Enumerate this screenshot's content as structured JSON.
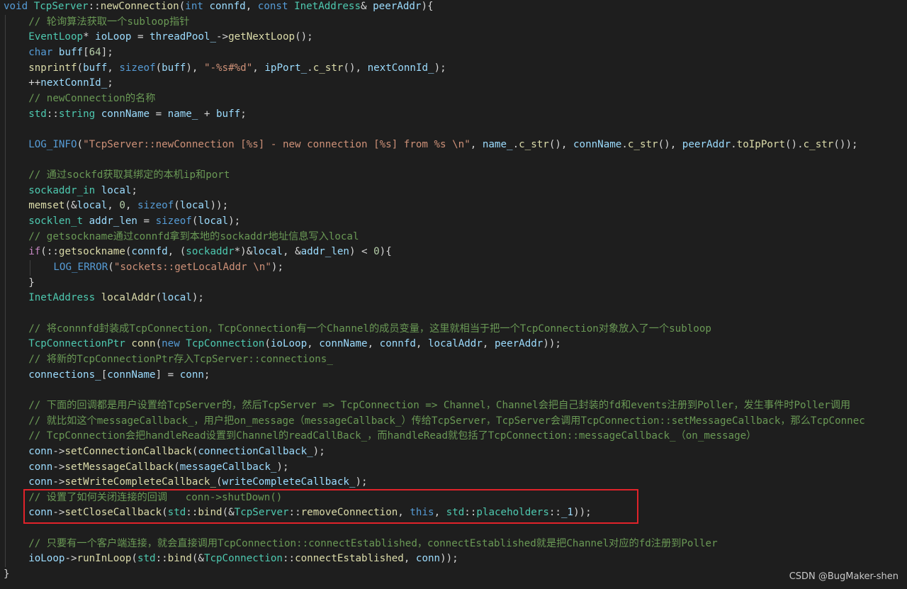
{
  "lines": [
    {
      "indent": 0,
      "tokens": [
        [
          "kw",
          "void"
        ],
        [
          "op",
          " "
        ],
        [
          "type",
          "TcpServer"
        ],
        [
          "op",
          "::"
        ],
        [
          "fn",
          "newConnection"
        ],
        [
          "op",
          "("
        ],
        [
          "kw",
          "int"
        ],
        [
          "op",
          " "
        ],
        [
          "var",
          "connfd"
        ],
        [
          "op",
          ", "
        ],
        [
          "kw",
          "const"
        ],
        [
          "op",
          " "
        ],
        [
          "type",
          "InetAddress"
        ],
        [
          "op",
          "& "
        ],
        [
          "var",
          "peerAddr"
        ],
        [
          "op",
          "){"
        ]
      ]
    },
    {
      "indent": 1,
      "tokens": [
        [
          "cmt",
          "// 轮询算法获取一个subloop指针"
        ]
      ]
    },
    {
      "indent": 1,
      "tokens": [
        [
          "type",
          "EventLoop"
        ],
        [
          "op",
          "* "
        ],
        [
          "var",
          "ioLoop"
        ],
        [
          "op",
          " = "
        ],
        [
          "var",
          "threadPool_"
        ],
        [
          "op",
          "->"
        ],
        [
          "fn",
          "getNextLoop"
        ],
        [
          "op",
          "();"
        ]
      ]
    },
    {
      "indent": 1,
      "tokens": [
        [
          "kw",
          "char"
        ],
        [
          "op",
          " "
        ],
        [
          "var",
          "buff"
        ],
        [
          "op",
          "["
        ],
        [
          "num",
          "64"
        ],
        [
          "op",
          "];"
        ]
      ]
    },
    {
      "indent": 1,
      "tokens": [
        [
          "fn",
          "snprintf"
        ],
        [
          "op",
          "("
        ],
        [
          "var",
          "buff"
        ],
        [
          "op",
          ", "
        ],
        [
          "kw",
          "sizeof"
        ],
        [
          "op",
          "("
        ],
        [
          "var",
          "buff"
        ],
        [
          "op",
          "), "
        ],
        [
          "str",
          "\"-%s#%d\""
        ],
        [
          "op",
          ", "
        ],
        [
          "var",
          "ipPort_"
        ],
        [
          "op",
          "."
        ],
        [
          "fn",
          "c_str"
        ],
        [
          "op",
          "(), "
        ],
        [
          "var",
          "nextConnId_"
        ],
        [
          "op",
          ");"
        ]
      ]
    },
    {
      "indent": 1,
      "tokens": [
        [
          "op",
          "++"
        ],
        [
          "var",
          "nextConnId_"
        ],
        [
          "op",
          ";"
        ]
      ]
    },
    {
      "indent": 1,
      "tokens": [
        [
          "cmt",
          "// newConnection的名称"
        ]
      ]
    },
    {
      "indent": 1,
      "tokens": [
        [
          "ns",
          "std"
        ],
        [
          "op",
          "::"
        ],
        [
          "type",
          "string"
        ],
        [
          "op",
          " "
        ],
        [
          "var",
          "connName"
        ],
        [
          "op",
          " = "
        ],
        [
          "var",
          "name_"
        ],
        [
          "op",
          " + "
        ],
        [
          "var",
          "buff"
        ],
        [
          "op",
          ";"
        ]
      ]
    },
    {
      "indent": 0,
      "tokens": []
    },
    {
      "indent": 1,
      "tokens": [
        [
          "mac",
          "LOG_INFO"
        ],
        [
          "op",
          "("
        ],
        [
          "str",
          "\"TcpServer::newConnection [%s] - new connection [%s] from %s \\n\""
        ],
        [
          "op",
          ", "
        ],
        [
          "var",
          "name_"
        ],
        [
          "op",
          "."
        ],
        [
          "fn",
          "c_str"
        ],
        [
          "op",
          "(), "
        ],
        [
          "var",
          "connName"
        ],
        [
          "op",
          "."
        ],
        [
          "fn",
          "c_str"
        ],
        [
          "op",
          "(), "
        ],
        [
          "var",
          "peerAddr"
        ],
        [
          "op",
          "."
        ],
        [
          "fn",
          "toIpPort"
        ],
        [
          "op",
          "()."
        ],
        [
          "fn",
          "c_str"
        ],
        [
          "op",
          "());"
        ]
      ]
    },
    {
      "indent": 0,
      "tokens": []
    },
    {
      "indent": 1,
      "tokens": [
        [
          "cmt",
          "// 通过sockfd获取其绑定的本机ip和port"
        ]
      ]
    },
    {
      "indent": 1,
      "tokens": [
        [
          "type",
          "sockaddr_in"
        ],
        [
          "op",
          " "
        ],
        [
          "var",
          "local"
        ],
        [
          "op",
          ";"
        ]
      ]
    },
    {
      "indent": 1,
      "tokens": [
        [
          "fn",
          "memset"
        ],
        [
          "op",
          "(&"
        ],
        [
          "var",
          "local"
        ],
        [
          "op",
          ", "
        ],
        [
          "num",
          "0"
        ],
        [
          "op",
          ", "
        ],
        [
          "kw",
          "sizeof"
        ],
        [
          "op",
          "("
        ],
        [
          "var",
          "local"
        ],
        [
          "op",
          "));"
        ]
      ]
    },
    {
      "indent": 1,
      "tokens": [
        [
          "type",
          "socklen_t"
        ],
        [
          "op",
          " "
        ],
        [
          "var",
          "addr_len"
        ],
        [
          "op",
          " = "
        ],
        [
          "kw",
          "sizeof"
        ],
        [
          "op",
          "("
        ],
        [
          "var",
          "local"
        ],
        [
          "op",
          ");"
        ]
      ]
    },
    {
      "indent": 1,
      "tokens": [
        [
          "cmt",
          "// getsockname通过connfd拿到本地的sockaddr地址信息写入local"
        ]
      ]
    },
    {
      "indent": 1,
      "tokens": [
        [
          "ctl",
          "if"
        ],
        [
          "op",
          "(::"
        ],
        [
          "fn",
          "getsockname"
        ],
        [
          "op",
          "("
        ],
        [
          "var",
          "connfd"
        ],
        [
          "op",
          ", ("
        ],
        [
          "type",
          "sockaddr"
        ],
        [
          "op",
          "*)&"
        ],
        [
          "var",
          "local"
        ],
        [
          "op",
          ", &"
        ],
        [
          "var",
          "addr_len"
        ],
        [
          "op",
          ") < "
        ],
        [
          "num",
          "0"
        ],
        [
          "op",
          "){"
        ]
      ]
    },
    {
      "indent": 2,
      "tokens": [
        [
          "mac",
          "LOG_ERROR"
        ],
        [
          "op",
          "("
        ],
        [
          "str",
          "\"sockets::getLocalAddr \\n\""
        ],
        [
          "op",
          ");"
        ]
      ]
    },
    {
      "indent": 1,
      "tokens": [
        [
          "op",
          "}"
        ]
      ]
    },
    {
      "indent": 1,
      "tokens": [
        [
          "type",
          "InetAddress"
        ],
        [
          "op",
          " "
        ],
        [
          "fn",
          "localAddr"
        ],
        [
          "op",
          "("
        ],
        [
          "var",
          "local"
        ],
        [
          "op",
          ");"
        ]
      ]
    },
    {
      "indent": 0,
      "tokens": []
    },
    {
      "indent": 1,
      "tokens": [
        [
          "cmt",
          "// 将connnfd封装成TcpConnection，TcpConnection有一个Channel的成员变量，这里就相当于把一个TcpConnection对象放入了一个subloop"
        ]
      ]
    },
    {
      "indent": 1,
      "tokens": [
        [
          "type",
          "TcpConnectionPtr"
        ],
        [
          "op",
          " "
        ],
        [
          "fn",
          "conn"
        ],
        [
          "op",
          "("
        ],
        [
          "kw",
          "new"
        ],
        [
          "op",
          " "
        ],
        [
          "type",
          "TcpConnection"
        ],
        [
          "op",
          "("
        ],
        [
          "var",
          "ioLoop"
        ],
        [
          "op",
          ", "
        ],
        [
          "var",
          "connName"
        ],
        [
          "op",
          ", "
        ],
        [
          "var",
          "connfd"
        ],
        [
          "op",
          ", "
        ],
        [
          "var",
          "localAddr"
        ],
        [
          "op",
          ", "
        ],
        [
          "var",
          "peerAddr"
        ],
        [
          "op",
          "));"
        ]
      ]
    },
    {
      "indent": 1,
      "tokens": [
        [
          "cmt",
          "// 将新的TcpConnectionPtr存入TcpServer::connections_"
        ]
      ]
    },
    {
      "indent": 1,
      "tokens": [
        [
          "var",
          "connections_"
        ],
        [
          "op",
          "["
        ],
        [
          "var",
          "connName"
        ],
        [
          "op",
          "] = "
        ],
        [
          "var",
          "conn"
        ],
        [
          "op",
          ";"
        ]
      ]
    },
    {
      "indent": 0,
      "tokens": []
    },
    {
      "indent": 1,
      "tokens": [
        [
          "cmt",
          "// 下面的回调都是用户设置给TcpServer的，然后TcpServer => TcpConnection => Channel，Channel会把自己封装的fd和events注册到Poller，发生事件时Poller调用"
        ]
      ]
    },
    {
      "indent": 1,
      "tokens": [
        [
          "cmt",
          "// 就比如这个messageCallback_，用户把on_message（messageCallback_）传给TcpServer，TcpServer会调用TcpConnection::setMessageCallback，那么TcpConnec"
        ]
      ]
    },
    {
      "indent": 1,
      "tokens": [
        [
          "cmt",
          "// TcpConnection会把handleRead设置到Channel的readCallBack_，而handleRead就包括了TcpConnection::messageCallback_（on_message）"
        ]
      ]
    },
    {
      "indent": 1,
      "tokens": [
        [
          "var",
          "conn"
        ],
        [
          "op",
          "->"
        ],
        [
          "fn",
          "setConnectionCallback"
        ],
        [
          "op",
          "("
        ],
        [
          "var",
          "connectionCallback_"
        ],
        [
          "op",
          ");"
        ]
      ]
    },
    {
      "indent": 1,
      "tokens": [
        [
          "var",
          "conn"
        ],
        [
          "op",
          "->"
        ],
        [
          "fn",
          "setMessageCallback"
        ],
        [
          "op",
          "("
        ],
        [
          "var",
          "messageCallback_"
        ],
        [
          "op",
          ");"
        ]
      ]
    },
    {
      "indent": 1,
      "tokens": [
        [
          "var",
          "conn"
        ],
        [
          "op",
          "->"
        ],
        [
          "fn",
          "setWriteCompleteCallback_"
        ],
        [
          "op",
          "("
        ],
        [
          "var",
          "writeCompleteCallback_"
        ],
        [
          "op",
          ");"
        ]
      ]
    },
    {
      "indent": 1,
      "tokens": [
        [
          "cmt",
          "// 设置了如何关闭连接的回调   conn->shutDown()"
        ]
      ]
    },
    {
      "indent": 1,
      "tokens": [
        [
          "var",
          "conn"
        ],
        [
          "op",
          "->"
        ],
        [
          "fn",
          "setCloseCallback"
        ],
        [
          "op",
          "("
        ],
        [
          "ns",
          "std"
        ],
        [
          "op",
          "::"
        ],
        [
          "fn",
          "bind"
        ],
        [
          "op",
          "(&"
        ],
        [
          "type",
          "TcpServer"
        ],
        [
          "op",
          "::"
        ],
        [
          "fn",
          "removeConnection"
        ],
        [
          "op",
          ", "
        ],
        [
          "kw",
          "this"
        ],
        [
          "op",
          ", "
        ],
        [
          "ns",
          "std"
        ],
        [
          "op",
          "::"
        ],
        [
          "ns",
          "placeholders"
        ],
        [
          "op",
          "::"
        ],
        [
          "var",
          "_1"
        ],
        [
          "op",
          "));"
        ]
      ]
    },
    {
      "indent": 0,
      "tokens": []
    },
    {
      "indent": 1,
      "tokens": [
        [
          "cmt",
          "// 只要有一个客户端连接，就会直接调用TcpConnection::connectEstablished，connectEstablished就是把Channel对应的fd注册到Poller"
        ]
      ]
    },
    {
      "indent": 1,
      "tokens": [
        [
          "var",
          "ioLoop"
        ],
        [
          "op",
          "->"
        ],
        [
          "fn",
          "runInLoop"
        ],
        [
          "op",
          "("
        ],
        [
          "ns",
          "std"
        ],
        [
          "op",
          "::"
        ],
        [
          "fn",
          "bind"
        ],
        [
          "op",
          "(&"
        ],
        [
          "type",
          "TcpConnection"
        ],
        [
          "op",
          "::"
        ],
        [
          "fn",
          "connectEstablished"
        ],
        [
          "op",
          ", "
        ],
        [
          "var",
          "conn"
        ],
        [
          "op",
          "));"
        ]
      ]
    },
    {
      "indent": 0,
      "tokens": [
        [
          "op",
          "}"
        ]
      ]
    }
  ],
  "watermark": "CSDN @BugMaker-shen"
}
